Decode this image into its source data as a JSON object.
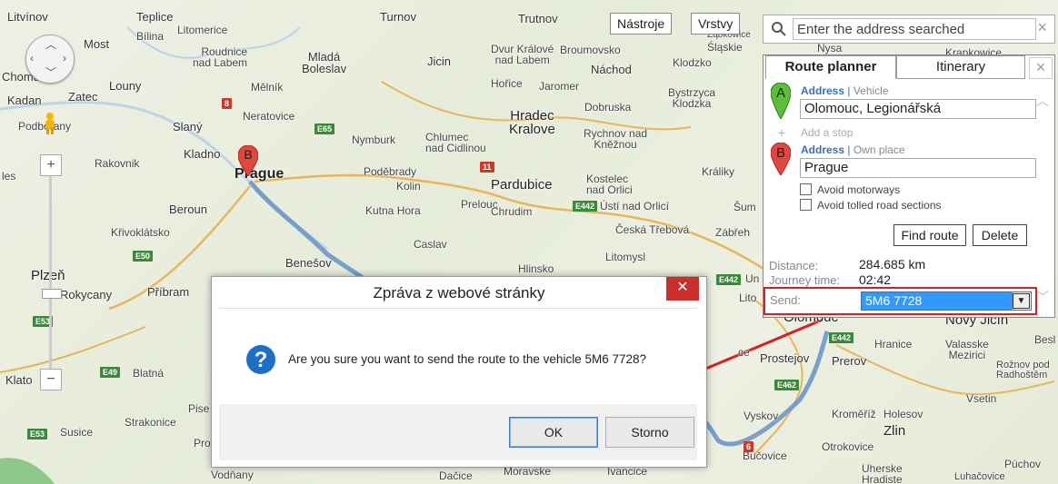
{
  "map": {
    "cities": [
      {
        "id": "litvinov",
        "name": "Litvínov"
      },
      {
        "id": "teplice",
        "name": "Teplice"
      },
      {
        "id": "most",
        "name": "Most"
      },
      {
        "id": "bilina",
        "name": "Bílina"
      },
      {
        "id": "litomerice",
        "name": "Litomerice"
      },
      {
        "id": "roudnice",
        "name": "Roudnice\nnad Labem"
      },
      {
        "id": "mlada",
        "name": "Mladá\nBoleslav"
      },
      {
        "id": "turnov",
        "name": "Turnov"
      },
      {
        "id": "jicin",
        "name": "Jicin"
      },
      {
        "id": "trutnov",
        "name": "Trutnov"
      },
      {
        "id": "dvur",
        "name": "Dvur Králové\nnad Labem"
      },
      {
        "id": "broumov",
        "name": "Broumovsko"
      },
      {
        "id": "nachod",
        "name": "Náchod"
      },
      {
        "id": "klodzko",
        "name": "Klodzko"
      },
      {
        "id": "slaskie",
        "name": "Śląskie"
      },
      {
        "id": "chomutov",
        "name": "Chomutov"
      },
      {
        "id": "louny",
        "name": "Louny"
      },
      {
        "id": "zatec",
        "name": "Zatec"
      },
      {
        "id": "kadan",
        "name": "Kadan"
      },
      {
        "id": "melnik",
        "name": "Mělník"
      },
      {
        "id": "neratovice",
        "name": "Neratovice"
      },
      {
        "id": "horice",
        "name": "Hořice"
      },
      {
        "id": "jaromer",
        "name": "Jaromer"
      },
      {
        "id": "hradec",
        "name": "Hradec\nKralove"
      },
      {
        "id": "dobruska",
        "name": "Dobruska"
      },
      {
        "id": "bystrzyca",
        "name": "Bystrzyca\nKlodzka"
      },
      {
        "id": "podborany",
        "name": "Podbořany"
      },
      {
        "id": "slany",
        "name": "Slaný"
      },
      {
        "id": "nymburk",
        "name": "Nymburk"
      },
      {
        "id": "chlumec",
        "name": "Chlumec\nnad Cidlinou"
      },
      {
        "id": "rychnov",
        "name": "Rychnov nad\nKněžnou"
      },
      {
        "id": "kladno",
        "name": "Kladno"
      },
      {
        "id": "rakovnik",
        "name": "Rakovnik"
      },
      {
        "id": "prague",
        "name": "Prague"
      },
      {
        "id": "podebrady",
        "name": "Poděbrady"
      },
      {
        "id": "kolin",
        "name": "Kolin"
      },
      {
        "id": "pardubice",
        "name": "Pardubice"
      },
      {
        "id": "kostelec",
        "name": "Kostelec\nnad Orlici"
      },
      {
        "id": "kraliky",
        "name": "Králiky"
      },
      {
        "id": "beroun",
        "name": "Beroun"
      },
      {
        "id": "kutna",
        "name": "Kutna Hora"
      },
      {
        "id": "prelouc",
        "name": "Prelouc"
      },
      {
        "id": "chrudim",
        "name": "Chrudim"
      },
      {
        "id": "usti",
        "name": "Ústí nad Orlicí"
      },
      {
        "id": "krivoklatsko",
        "name": "Křivoklátsko"
      },
      {
        "id": "ceska",
        "name": "Česká Třebová"
      },
      {
        "id": "zabreh",
        "name": "Zábřeh"
      },
      {
        "id": "caslav",
        "name": "Caslav"
      },
      {
        "id": "litomysl",
        "name": "Litomysl"
      },
      {
        "id": "benesov",
        "name": "Benešov"
      },
      {
        "id": "hlinsko",
        "name": "Hlinsko"
      },
      {
        "id": "plzen",
        "name": "Plzeň"
      },
      {
        "id": "rokycany",
        "name": "Rokycany"
      },
      {
        "id": "pribram",
        "name": "Příbram"
      },
      {
        "id": "olomouc",
        "name": "Olomouc"
      },
      {
        "id": "novyjicin",
        "name": "Nový Jičín"
      },
      {
        "id": "hranice",
        "name": "Hranice"
      },
      {
        "id": "valasske",
        "name": "Valasske\nMezirici"
      },
      {
        "id": "prostejov",
        "name": "Prostejov"
      },
      {
        "id": "prerov",
        "name": "Prerov"
      },
      {
        "id": "roznov",
        "name": "Rožnov pod\nRadhoštěm"
      },
      {
        "id": "klatovy",
        "name": "Klato"
      },
      {
        "id": "blatna",
        "name": "Blatná"
      },
      {
        "id": "vsetin",
        "name": "Vsetin"
      },
      {
        "id": "strakonice",
        "name": "Strakonice"
      },
      {
        "id": "pisek",
        "name": "Pise"
      },
      {
        "id": "vyskov",
        "name": "Vyskov"
      },
      {
        "id": "kromeriz",
        "name": "Kroměříž"
      },
      {
        "id": "holesov",
        "name": "Holesov"
      },
      {
        "id": "susice",
        "name": "Susice"
      },
      {
        "id": "zlin",
        "name": "Zlin"
      },
      {
        "id": "otrokovice",
        "name": "Otrokovice"
      },
      {
        "id": "bucovice",
        "name": "Bučovice"
      },
      {
        "id": "uherske",
        "name": "Uherske\nHradiste"
      },
      {
        "id": "puchov",
        "name": "Púchov"
      },
      {
        "id": "vodnany",
        "name": "Vodňany"
      },
      {
        "id": "dacice",
        "name": "Dačice"
      },
      {
        "id": "moravske",
        "name": "Moravske"
      },
      {
        "id": "ivancice",
        "name": "Ivancice"
      },
      {
        "id": "sumperk",
        "name": "Šum"
      },
      {
        "id": "lito",
        "name": "Lito"
      },
      {
        "id": "uni",
        "name": "Un"
      },
      {
        "id": "nysa",
        "name": "Nysa"
      },
      {
        "id": "krapkowice",
        "name": "Krapkowice"
      },
      {
        "id": "zabkowice",
        "name": "Ząbkowice"
      },
      {
        "id": "bes",
        "name": "Besl"
      },
      {
        "id": "luhacovice",
        "name": "Luhačovice"
      },
      {
        "id": "les",
        "name": "les"
      },
      {
        "id": "pro",
        "name": "Pro"
      },
      {
        "id": "ce",
        "name": "ce"
      }
    ],
    "shields": [
      {
        "id": "s8",
        "text": "8"
      },
      {
        "id": "e65",
        "text": "E65"
      },
      {
        "id": "s11",
        "text": "11"
      },
      {
        "id": "e442a",
        "text": "E442"
      },
      {
        "id": "e50",
        "text": "E50"
      },
      {
        "id": "e53",
        "text": "E53"
      },
      {
        "id": "e49",
        "text": "E49"
      },
      {
        "id": "e53b",
        "text": "E53"
      },
      {
        "id": "e442b",
        "text": "E442"
      },
      {
        "id": "e442c",
        "text": "E442"
      },
      {
        "id": "e462",
        "text": "E462"
      },
      {
        "id": "s6",
        "text": "6"
      }
    ],
    "markers": {
      "a_label": "A",
      "b_label": "B"
    },
    "route_color": "#6d97c9",
    "tools_button": "Nástroje",
    "layers_button": "Vrstvy",
    "zoom_in": "+",
    "zoom_out": "−"
  },
  "search": {
    "placeholder": "Enter the address searched",
    "close": "×"
  },
  "planner": {
    "tabs": [
      {
        "label": "Route planner",
        "active": true
      },
      {
        "label": "Itinerary",
        "active": false
      }
    ],
    "close": "×",
    "start": {
      "label": "Address",
      "sublabel": "Vehicle",
      "value": "Olomouc, Legionářská",
      "marker": "A"
    },
    "add_stop": "Add a stop",
    "end": {
      "label": "Address",
      "sublabel": "Own place",
      "value": "Prague",
      "marker": "B"
    },
    "options": [
      "Avoid motorways",
      "Avoid tolled road sections"
    ],
    "find_route": "Find route",
    "delete": "Delete",
    "distance_label": "Distance:",
    "distance_value": "284.685 km",
    "journey_label": "Journey time:",
    "journey_value": "02:42",
    "send_label": "Send:",
    "send_value": "5M6 7728",
    "accent": "#3a6fb0",
    "highlight": "#d92020"
  },
  "dialog": {
    "title": "Zpráva z webové stránky",
    "message": "Are you sure you want to send the route to the vehicle 5M6 7728?",
    "ok": "OK",
    "cancel": "Storno",
    "close": "✕",
    "icon": "?"
  },
  "annotation": {
    "arrow_color": "#d92020"
  }
}
